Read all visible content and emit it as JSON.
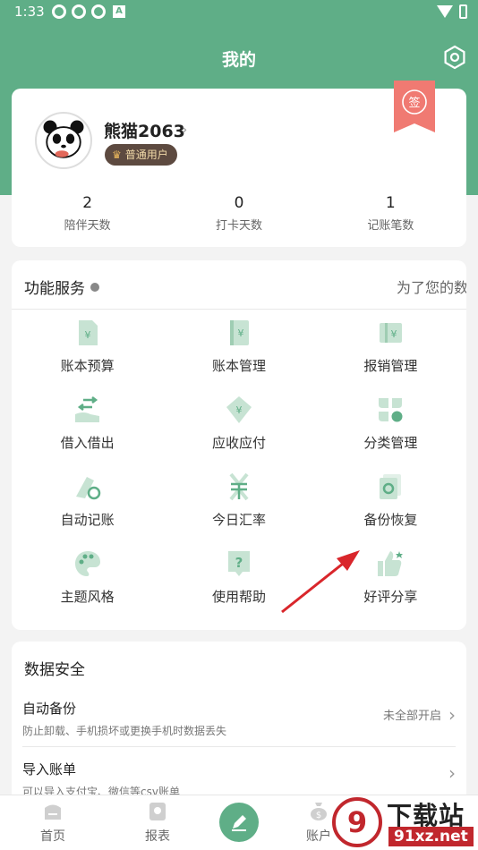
{
  "status_bar": {
    "time": "1:33",
    "notif_letter": "A"
  },
  "header": {
    "title": "我的",
    "settings_icon": "gear-icon"
  },
  "profile": {
    "name": "熊猫2063",
    "chevron": "›",
    "badge": "普通用户",
    "badge_icon": "crown-icon",
    "ribbon_text": "签",
    "stats": [
      {
        "value": "2",
        "label": "陪伴天数"
      },
      {
        "value": "0",
        "label": "打卡天数"
      },
      {
        "value": "1",
        "label": "记账笔数"
      }
    ]
  },
  "features": {
    "title": "功能服务",
    "marquee": "为了您的数",
    "items": [
      {
        "label": "账本预算",
        "icon": "budget-icon"
      },
      {
        "label": "账本管理",
        "icon": "ledger-icon"
      },
      {
        "label": "报销管理",
        "icon": "reimburse-icon"
      },
      {
        "label": "借入借出",
        "icon": "transfer-icon"
      },
      {
        "label": "应收应付",
        "icon": "receivable-icon"
      },
      {
        "label": "分类管理",
        "icon": "category-icon"
      },
      {
        "label": "自动记账",
        "icon": "auto-record-icon"
      },
      {
        "label": "今日汇率",
        "icon": "exchange-rate-icon"
      },
      {
        "label": "备份恢复",
        "icon": "backup-icon"
      },
      {
        "label": "主题风格",
        "icon": "palette-icon"
      },
      {
        "label": "使用帮助",
        "icon": "help-icon"
      },
      {
        "label": "好评分享",
        "icon": "thumbs-up-icon"
      }
    ]
  },
  "security": {
    "title": "数据安全",
    "rows": [
      {
        "title": "自动备份",
        "subtitle": "防止卸载、手机损坏或更换手机时数据丢失",
        "right": "未全部开启",
        "chevron": "›"
      },
      {
        "title": "导入账单",
        "subtitle": "可以导入支付宝、微信等csv账单",
        "right": "",
        "chevron": "›"
      }
    ]
  },
  "tabbar": {
    "tabs": [
      {
        "label": "首页",
        "icon": "home-icon"
      },
      {
        "label": "报表",
        "icon": "report-icon"
      },
      {
        "label": "账户",
        "icon": "account-icon"
      }
    ],
    "fab_icon": "pen-icon"
  },
  "watermark": {
    "line1": "下载站",
    "line2": "91xz.net",
    "logo_text": "9"
  },
  "colors": {
    "primary": "#5fae87",
    "icon_light": "#c7e3d3",
    "icon_dark": "#5fae87",
    "arrow": "#d9262b",
    "ribbon": "#f07a72"
  }
}
